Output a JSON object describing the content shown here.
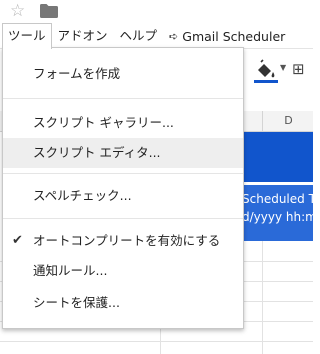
{
  "header": {
    "star_icon": "star-outline-icon",
    "folder_icon": "folder-icon"
  },
  "menubar": {
    "items": [
      {
        "label": "ツール",
        "active": true
      },
      {
        "label": "アドオン"
      },
      {
        "label": "ヘルプ"
      }
    ],
    "extension": {
      "icon": "arrow-right-icon",
      "label": "Gmail Scheduler"
    }
  },
  "toolbar": {
    "fill_color_icon": "paint-bucket-icon",
    "fill_color": "#1155cc",
    "borders_icon": "borders-icon"
  },
  "sheet": {
    "column_header_d": "D",
    "cell_line1": "Scheduled Ti",
    "cell_line2": "d/yyyy hh:m",
    "colors": {
      "header_fill": "#1155cc",
      "cell_fill": "#2a6ad8"
    }
  },
  "tools_menu": {
    "items": [
      {
        "label": "フォームを作成"
      },
      {
        "label": "スクリプト ギャラリー..."
      },
      {
        "label": "スクリプト エディタ...",
        "highlighted": true
      },
      {
        "label": "スペルチェック..."
      },
      {
        "label": "オートコンプリートを有効にする",
        "checked": true
      },
      {
        "label": "通知ルール..."
      },
      {
        "label": "シートを保護..."
      }
    ]
  }
}
